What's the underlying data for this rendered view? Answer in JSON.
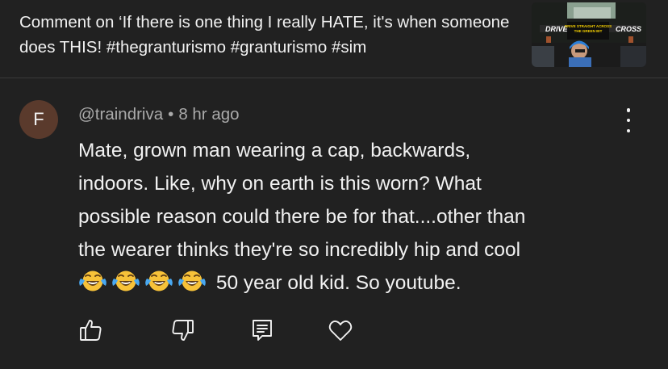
{
  "header": {
    "title": "Comment on ‘If there is one thing I really HATE, it's when someone does THIS! #thegranturismo #granturismo #sim",
    "thumbnail": {
      "text_left": "DRIVE",
      "text_right": "CROSS",
      "caption_line1": "DRIVE STRAIGHT ACROSS",
      "caption_line2": "THE GREEN BIT"
    }
  },
  "comment": {
    "avatar_letter": "F",
    "avatar_color": "#5a3a2c",
    "author": "@traindriva",
    "separator": "•",
    "time": "8 hr ago",
    "lines": [
      "Mate, grown man wearing a cap, backwards,",
      "indoors. Like, why on earth is this worn? What",
      "possible reason could there be for that....other than",
      "the wearer thinks they're so incredibly hip and cool"
    ],
    "last_line_text": "50 year old kid. So youtube.",
    "emoji_count": 4,
    "emoji_name": "face-with-tears-of-joy"
  },
  "actions": {
    "icons": [
      "thumbs-up-icon",
      "thumbs-down-icon",
      "reply-icon",
      "heart-icon"
    ]
  },
  "colors": {
    "background": "#212121",
    "text": "#f1f1f1",
    "secondary_text": "#aaaaaa"
  }
}
